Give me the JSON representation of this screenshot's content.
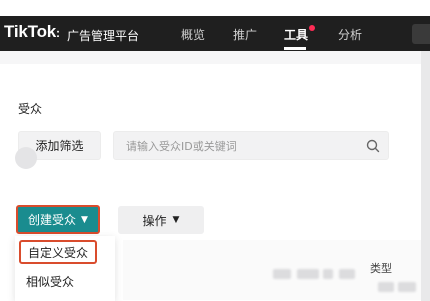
{
  "header": {
    "logo": "TikTok",
    "logo_suffix": ":",
    "platform": "广告管理平台",
    "nav": [
      {
        "label": "概览"
      },
      {
        "label": "推广"
      },
      {
        "label": "工具",
        "active": true,
        "has_dot": true
      },
      {
        "label": "分析"
      }
    ]
  },
  "audience": {
    "title": "受众",
    "add_filter_label": "添加筛选",
    "search_placeholder": "请输入受众ID或关键词"
  },
  "toolbar": {
    "create_label": "创建受众",
    "operate_label": "操作"
  },
  "create_menu": {
    "items": [
      {
        "label": "自定义受众",
        "highlighted": true
      },
      {
        "label": "相似受众"
      }
    ]
  },
  "table": {
    "columns": [
      "类型"
    ]
  },
  "colors": {
    "header_bg": "#1f1f1f",
    "accent": "#1a8c8f",
    "highlight_border": "#d94c2d",
    "notification_dot": "#fe2c55"
  }
}
